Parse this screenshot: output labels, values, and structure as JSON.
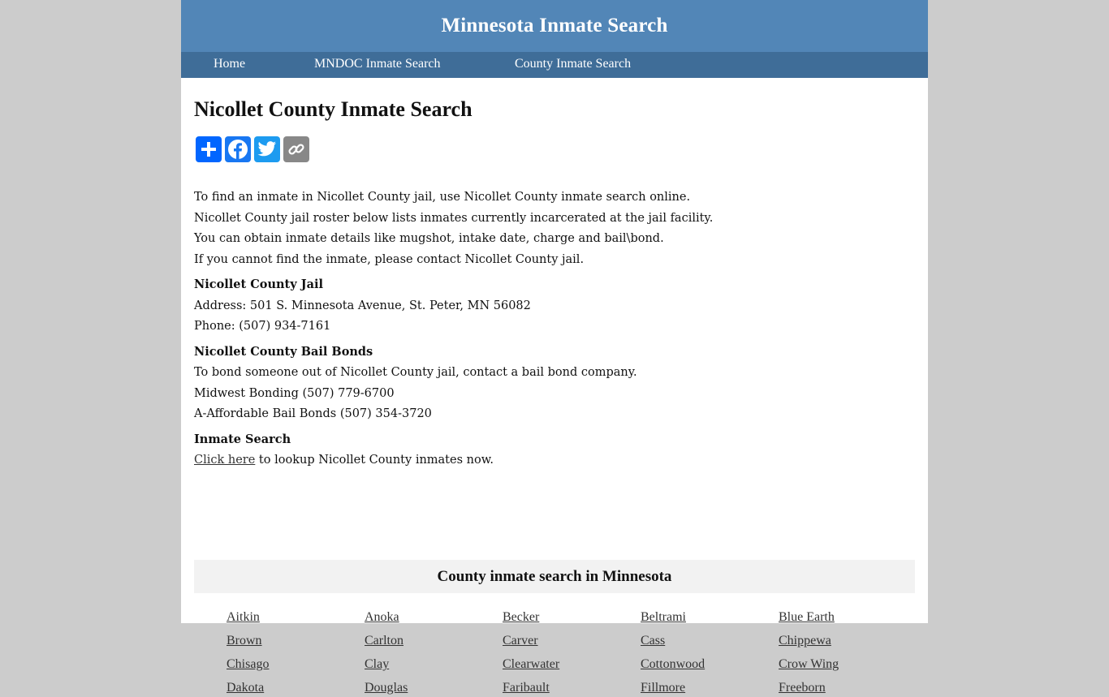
{
  "header": {
    "site_title": "Minnesota Inmate Search"
  },
  "nav": {
    "items": [
      {
        "label": "Home"
      },
      {
        "label": "MNDOC Inmate Search"
      },
      {
        "label": "County Inmate Search"
      }
    ]
  },
  "main": {
    "title": "Nicollet County Inmate Search",
    "share_buttons": [
      {
        "name": "add-share",
        "icon": "plus-icon"
      },
      {
        "name": "facebook",
        "icon": "facebook-icon"
      },
      {
        "name": "twitter",
        "icon": "twitter-icon"
      },
      {
        "name": "copy-link",
        "icon": "link-icon"
      }
    ],
    "intro": [
      "To find an inmate in Nicollet County jail, use Nicollet County inmate search online.",
      "Nicollet County jail roster below lists inmates currently incarcerated at the jail facility.",
      "You can obtain inmate details like mugshot, intake date, charge and bail\\bond.",
      "If you cannot find the inmate, please contact Nicollet County jail."
    ],
    "jail": {
      "heading": "Nicollet County Jail",
      "address": "Address: 501 S. Minnesota Avenue, St. Peter, MN 56082",
      "phone": "Phone: (507) 934-7161"
    },
    "bail": {
      "heading": "Nicollet County Bail Bonds",
      "text": "To bond someone out of Nicollet County jail, contact a bail bond company.",
      "companies": [
        "Midwest Bonding (507) 779-6700",
        "A-Affordable Bail Bonds (507) 354-3720"
      ]
    },
    "inmate_search": {
      "heading": "Inmate Search",
      "link_label": "Click here",
      "link_suffix": " to lookup Nicollet County inmates now."
    }
  },
  "counties": {
    "heading": "County inmate search in Minnesota",
    "items": [
      "Aitkin",
      "Anoka",
      "Becker",
      "Beltrami",
      "Blue Earth",
      "Brown",
      "Carlton",
      "Carver",
      "Cass",
      "Chippewa",
      "Chisago",
      "Clay",
      "Clearwater",
      "Cottonwood",
      "Crow Wing",
      "Dakota",
      "Douglas",
      "Faribault",
      "Fillmore",
      "Freeborn"
    ]
  },
  "colors": {
    "header_bg": "#5286b7",
    "nav_bg": "#3f6d98",
    "page_bg": "#cccccc",
    "section_bg": "#f2f2f2"
  }
}
